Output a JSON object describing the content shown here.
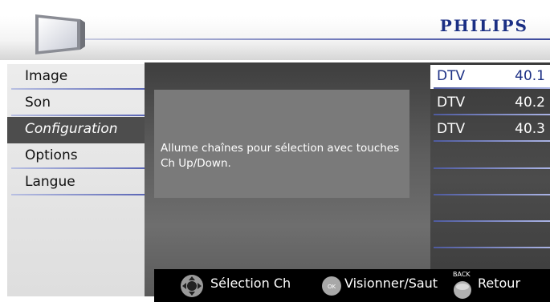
{
  "header": {
    "brand": "PHILIPS",
    "icon": "tv-icon"
  },
  "menu": {
    "items": [
      {
        "label": "Image",
        "selected": false
      },
      {
        "label": "Son",
        "selected": false
      },
      {
        "label": "Configuration",
        "selected": true
      },
      {
        "label": "Options",
        "selected": false
      },
      {
        "label": "Langue",
        "selected": false
      }
    ]
  },
  "description": "Allume chaînes pour sélection avec touches Ch Up/Down.",
  "channels": [
    {
      "type": "DTV",
      "number": "40.1",
      "selected": true
    },
    {
      "type": "DTV",
      "number": "40.2",
      "selected": false
    },
    {
      "type": "DTV",
      "number": "40.3",
      "selected": false
    }
  ],
  "footer": {
    "select": {
      "icon": "dpad-icon",
      "label": "Sélection Ch"
    },
    "ok": {
      "icon": "ok-button-icon",
      "badge": "OK",
      "label": "Visionner/Saut"
    },
    "back": {
      "icon": "back-button-icon",
      "badge": "BACK",
      "label": "Retour"
    }
  },
  "colors": {
    "brand": "#1b2f84",
    "selected_menu_bg": "#4d4d4d",
    "footer_bg": "#000000"
  }
}
